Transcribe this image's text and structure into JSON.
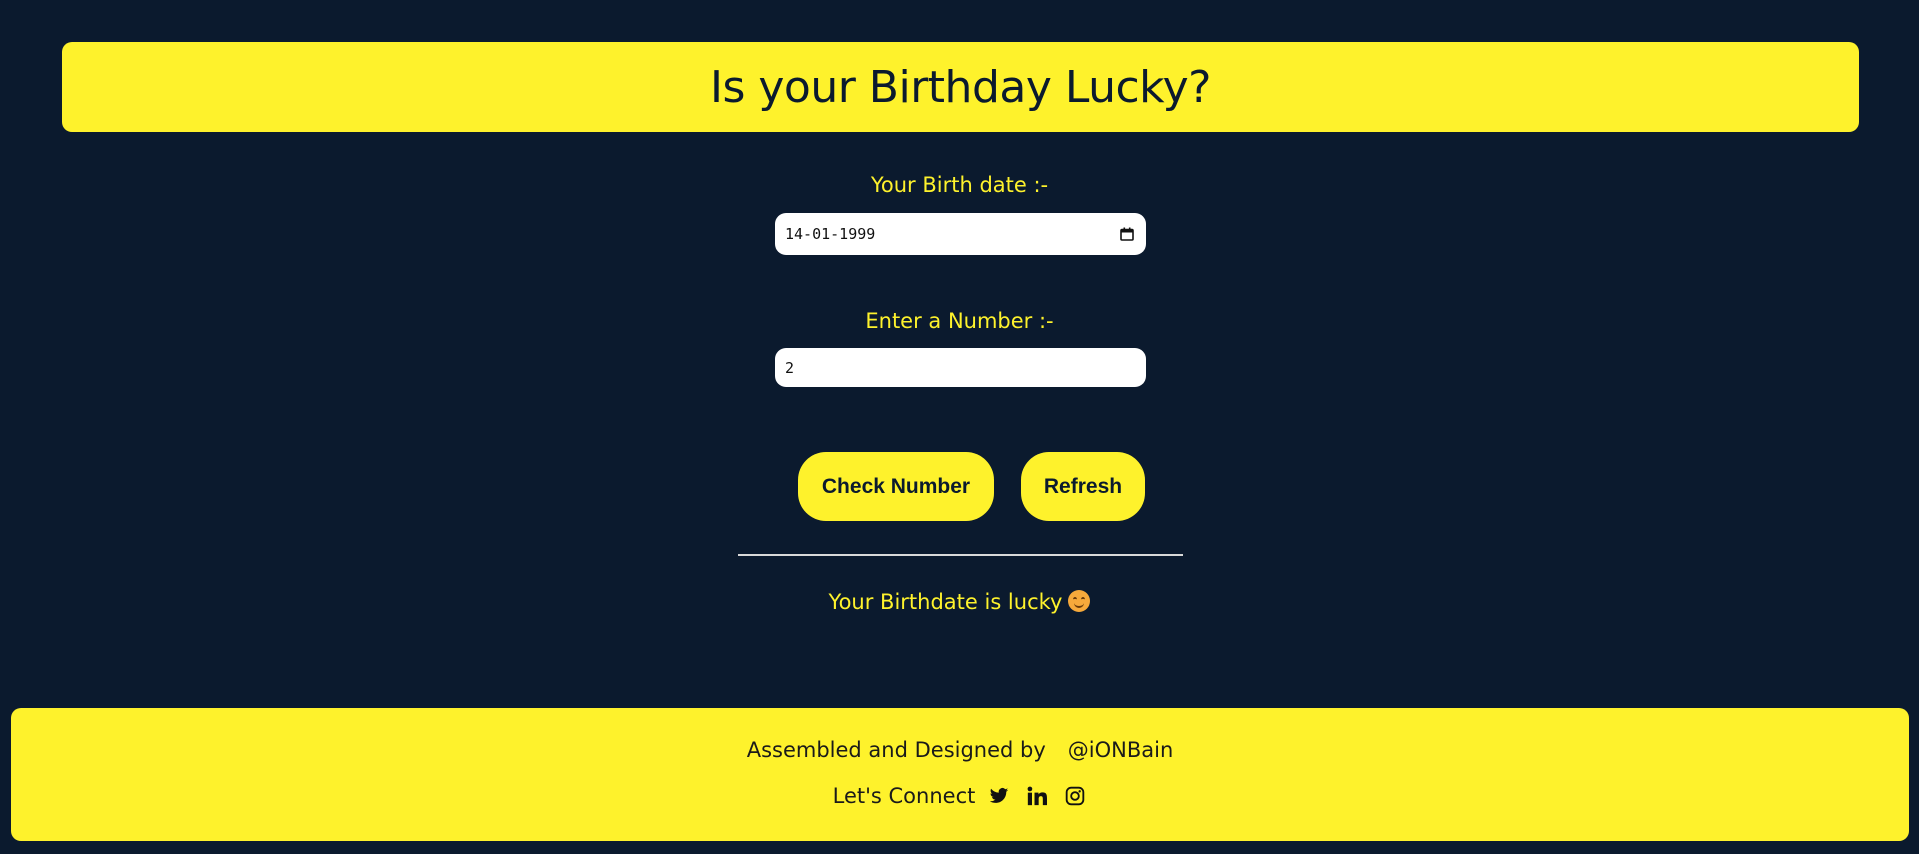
{
  "header": {
    "title": "Is your Birthday Lucky?"
  },
  "form": {
    "birthdate_label": "Your Birth date :-",
    "birthdate_value": "14-01-1999",
    "number_label": "Enter a Number :-",
    "number_value": "2"
  },
  "buttons": {
    "check_label": "Check Number",
    "refresh_label": "Refresh"
  },
  "result": {
    "message": "Your Birthdate is lucky",
    "emoji_icon": "smiling-face-icon"
  },
  "footer": {
    "credit_text": "Assembled and Designed by",
    "handle": "@iONBain",
    "connect_text": "Let's Connect",
    "social_icons": [
      "twitter-icon",
      "linkedin-icon",
      "instagram-icon"
    ]
  },
  "colors": {
    "background": "#0b1a2e",
    "accent": "#fef22c"
  }
}
